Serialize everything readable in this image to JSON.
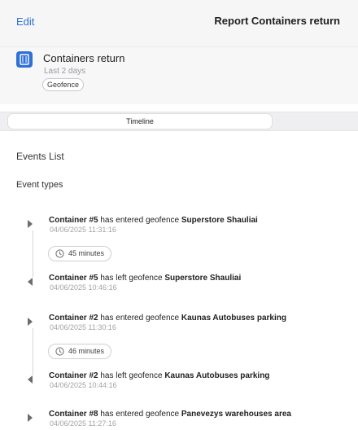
{
  "header": {
    "edit_label": "Edit",
    "title": "Report Containers return"
  },
  "summary": {
    "icon": "container-report-icon",
    "title": "Containers return",
    "subtitle": "Last 2 days",
    "chip": "Geofence"
  },
  "segment": {
    "tabs": [
      "Timeline"
    ]
  },
  "sections": {
    "events_list": "Events List",
    "event_types": "Event types"
  },
  "events": [
    {
      "subject": "Container #5",
      "action": " has entered geofence ",
      "place": "Superstore Shauliai",
      "time": "04/06/2025 11:31:16",
      "direction": "entered"
    },
    {
      "duration": "45 minutes"
    },
    {
      "subject": "Container #5",
      "action": " has left geofence ",
      "place": "Superstore Shauliai",
      "time": "04/06/2025 10:46:16",
      "direction": "left"
    },
    {
      "subject": "Container #2",
      "action": " has entered geofence ",
      "place": "Kaunas Autobuses parking",
      "time": "04/06/2025 11:30:16",
      "direction": "entered"
    },
    {
      "duration": "46 minutes"
    },
    {
      "subject": "Container #2",
      "action": " has left geofence ",
      "place": "Kaunas Autobuses parking",
      "time": "04/06/2025 10:44:16",
      "direction": "left"
    },
    {
      "subject": "Container #8",
      "action": " has entered geofence ",
      "place": "Panevezys warehouses area",
      "time": "04/06/2025 11:27:16",
      "direction": "entered"
    }
  ],
  "colors": {
    "accent": "#2f6fd6",
    "header_bg": "#f6f6f7",
    "muted_text": "#a3a3a8"
  }
}
